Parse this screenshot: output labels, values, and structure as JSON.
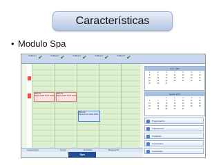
{
  "slide": {
    "title": "Características",
    "bullet": "Modulo Spa"
  },
  "screenshot": {
    "columns": [
      {
        "label": "Cabina 1"
      },
      {
        "label": "Cabina 2"
      },
      {
        "label": "Cabina 3"
      },
      {
        "label": "Cabina 4"
      },
      {
        "label": "Cabina 5"
      }
    ],
    "appointments": [
      {
        "title": "Reserva",
        "detail": "Desde 15:00 hasta 16:00"
      },
      {
        "title": "Reserva",
        "detail": "Desde 15:00 hasta 16:00"
      },
      {
        "title": "Reserva",
        "detail": "Desde 17:00 hasta 18:00"
      }
    ],
    "side": {
      "month1": "Julio 2007",
      "month2": "Agosto 2007",
      "menu": [
        "Programación",
        "Tratamientos",
        "Terapistas",
        "Cancelación",
        "Cancelados"
      ]
    },
    "tabs": [
      "Características",
      "Tecnica",
      "Empleados",
      "Equipamiento"
    ],
    "footer_label": "Spa"
  }
}
